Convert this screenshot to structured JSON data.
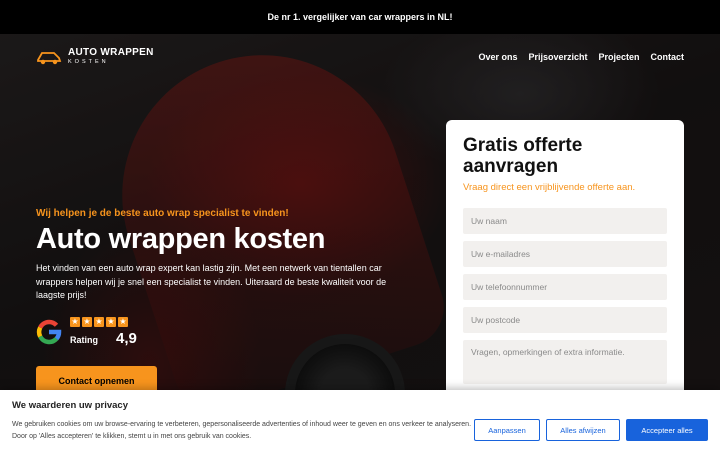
{
  "topbar": {
    "text": "De nr 1. vergelijker van car wrappers in NL!"
  },
  "logo": {
    "title": "AUTO WRAPPEN",
    "subtitle": "KOSTEN",
    "icon": "car-icon"
  },
  "nav": {
    "items": [
      "Over ons",
      "Prijsoverzicht",
      "Projecten",
      "Contact"
    ]
  },
  "hero": {
    "tagline": "Wij helpen je de beste auto wrap specialist te vinden!",
    "headline": "Auto wrappen kosten",
    "intro": "Het vinden van een auto wrap expert kan lastig zijn. Met een netwerk van tientallen car wrappers helpen wij je snel een specialist te vinden. Uiteraard de beste kwaliteit voor de laagste prijs!",
    "rating": {
      "label": "Rating",
      "score": "4,9",
      "stars": 5,
      "icon": "google-icon"
    },
    "cta_label": "Contact opnemen"
  },
  "form": {
    "title": "Gratis offerte aanvragen",
    "subtitle": "Vraag direct een vrijblijvende offerte aan.",
    "name_placeholder": "Uw naam",
    "email_placeholder": "Uw e-mailadres",
    "phone_placeholder": "Uw telefoonnummer",
    "postcode_placeholder": "Uw postcode",
    "message_placeholder": "Vragen, opmerkingen of extra informatie."
  },
  "cookie": {
    "title": "We waarderen uw privacy",
    "text": "We gebruiken cookies om uw browse-ervaring te verbeteren, gepersonaliseerde advertenties of inhoud weer te geven en ons verkeer te analyseren. Door op 'Alles accepteren' te klikken, stemt u in met ons gebruik van cookies.",
    "customize_label": "Aanpassen",
    "reject_label": "Alles afwijzen",
    "accept_label": "Accepteer alles"
  },
  "colors": {
    "accent": "#f7941d",
    "cookie_button": "#1863dc",
    "topbar": "#000000"
  }
}
